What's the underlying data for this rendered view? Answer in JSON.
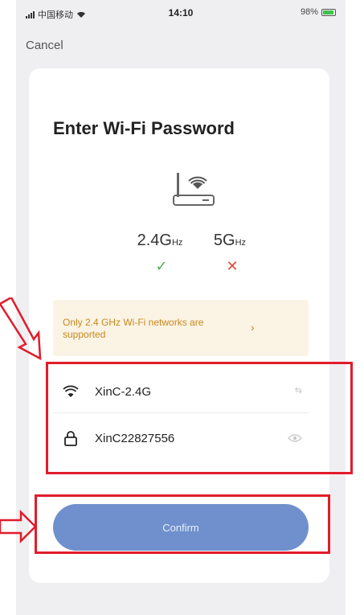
{
  "status_bar": {
    "carrier": "中国移动",
    "time": "14:10",
    "battery": "98%"
  },
  "nav": {
    "cancel_label": "Cancel"
  },
  "page": {
    "title": "Enter Wi-Fi Password"
  },
  "bands": {
    "band_24_main": "2.4G",
    "band_24_unit": "Hz",
    "band_5_main": "5G",
    "band_5_unit": "Hz",
    "band_24_status": "✓",
    "band_5_status": "✕"
  },
  "notice": {
    "text": "Only 2.4 GHz Wi-Fi networks are supported",
    "chevron": "›"
  },
  "form": {
    "ssid_value": "XinC-2.4G",
    "ssid_action": "⇆",
    "password_value": "XinC22827556"
  },
  "confirm": {
    "label": "Confirm"
  },
  "colors": {
    "accent": "#6f90cc",
    "notice_text": "#c8871e",
    "check": "#4cb050",
    "cross": "#e24a3b",
    "annotation": "#e21c2b"
  },
  "icons": {
    "router": "router-icon",
    "wifi": "wifi-icon",
    "lock": "lock-icon",
    "eye": "eye-icon",
    "check": "check-icon",
    "cross": "close-icon"
  }
}
